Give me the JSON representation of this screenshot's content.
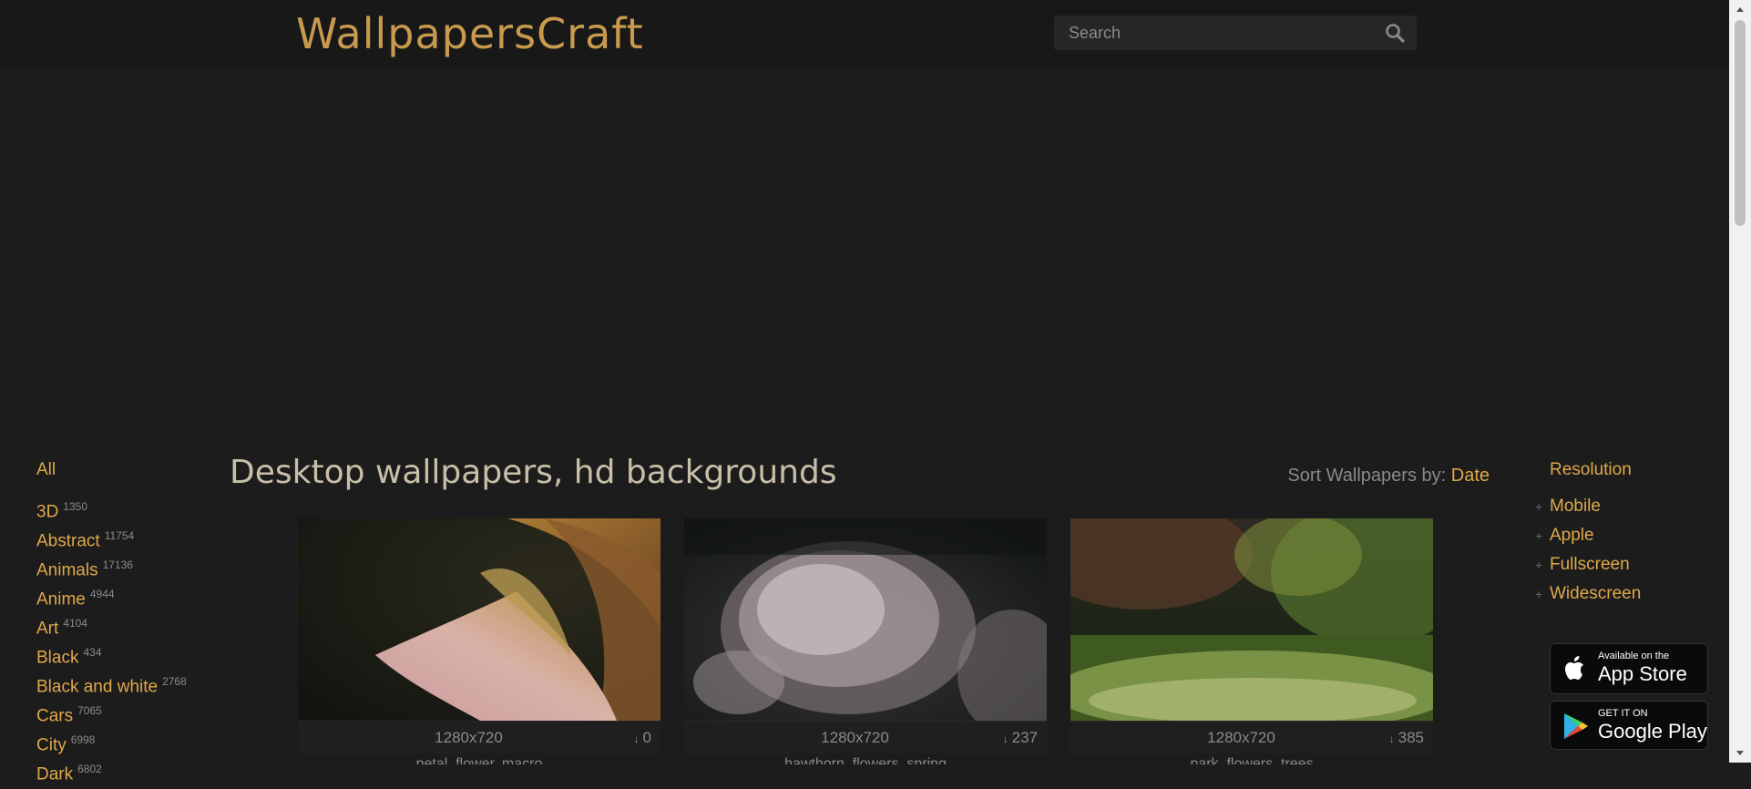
{
  "header": {
    "logo": "WallpapersCraft",
    "search_placeholder": "Search",
    "search_icon": "search-icon"
  },
  "categories": {
    "all": "All",
    "items": [
      {
        "label": "3D",
        "count": "1350"
      },
      {
        "label": "Abstract",
        "count": "11754"
      },
      {
        "label": "Animals",
        "count": "17136"
      },
      {
        "label": "Anime",
        "count": "4944"
      },
      {
        "label": "Art",
        "count": "4104"
      },
      {
        "label": "Black",
        "count": "434"
      },
      {
        "label": "Black and white",
        "count": "2768"
      },
      {
        "label": "Cars",
        "count": "7065"
      },
      {
        "label": "City",
        "count": "6998"
      },
      {
        "label": "Dark",
        "count": "6802"
      }
    ]
  },
  "main": {
    "title": "Desktop wallpapers, hd backgrounds",
    "sort_label": "Sort Wallpapers by:",
    "sort_value": "Date"
  },
  "wallpapers": [
    {
      "resolution": "1280x720",
      "downloads": "0",
      "tags": "petal, flower, macro"
    },
    {
      "resolution": "1280x720",
      "downloads": "237",
      "tags": "hawthorn, flowers, spring"
    },
    {
      "resolution": "1280x720",
      "downloads": "385",
      "tags": "park, flowers, trees"
    }
  ],
  "resolution_menu": {
    "heading": "Resolution",
    "items": [
      "Mobile",
      "Apple",
      "Fullscreen",
      "Widescreen"
    ]
  },
  "stores": {
    "appstore_small": "Available on the",
    "appstore_big": "App Store",
    "gplay_small": "GET IT ON",
    "gplay_big": "Google Play"
  },
  "colors": {
    "accent": "#e0a84a",
    "background": "#1c1c1c",
    "header_bg": "#181818"
  }
}
